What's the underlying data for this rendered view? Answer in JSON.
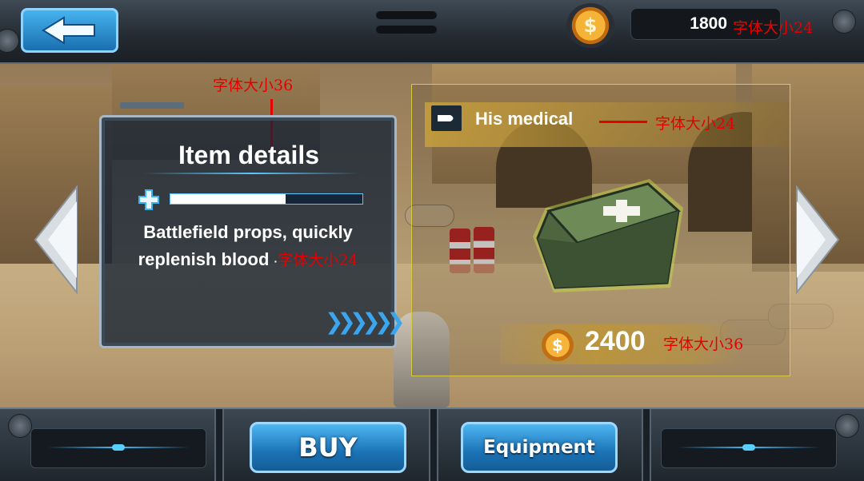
{
  "header": {
    "gold_amount": "1800",
    "gold_annotation": "字体大小24"
  },
  "item_details": {
    "title": "Item details",
    "title_annotation": "字体大小36",
    "health_fill": 0.6,
    "description_line1": "Battlefield props, quickly",
    "description_line2": "replenish blood",
    "description_annotation": "字体大小24"
  },
  "item": {
    "name": "His medical",
    "name_annotation": "字体大小24",
    "price": "2400",
    "price_annotation": "字体大小36"
  },
  "footer": {
    "buy_label": "BUY",
    "equipment_label": "Equipment"
  },
  "colors": {
    "accent_blue": "#1b73b6",
    "gold": "#f5b337",
    "annotation_red": "#e60000"
  }
}
